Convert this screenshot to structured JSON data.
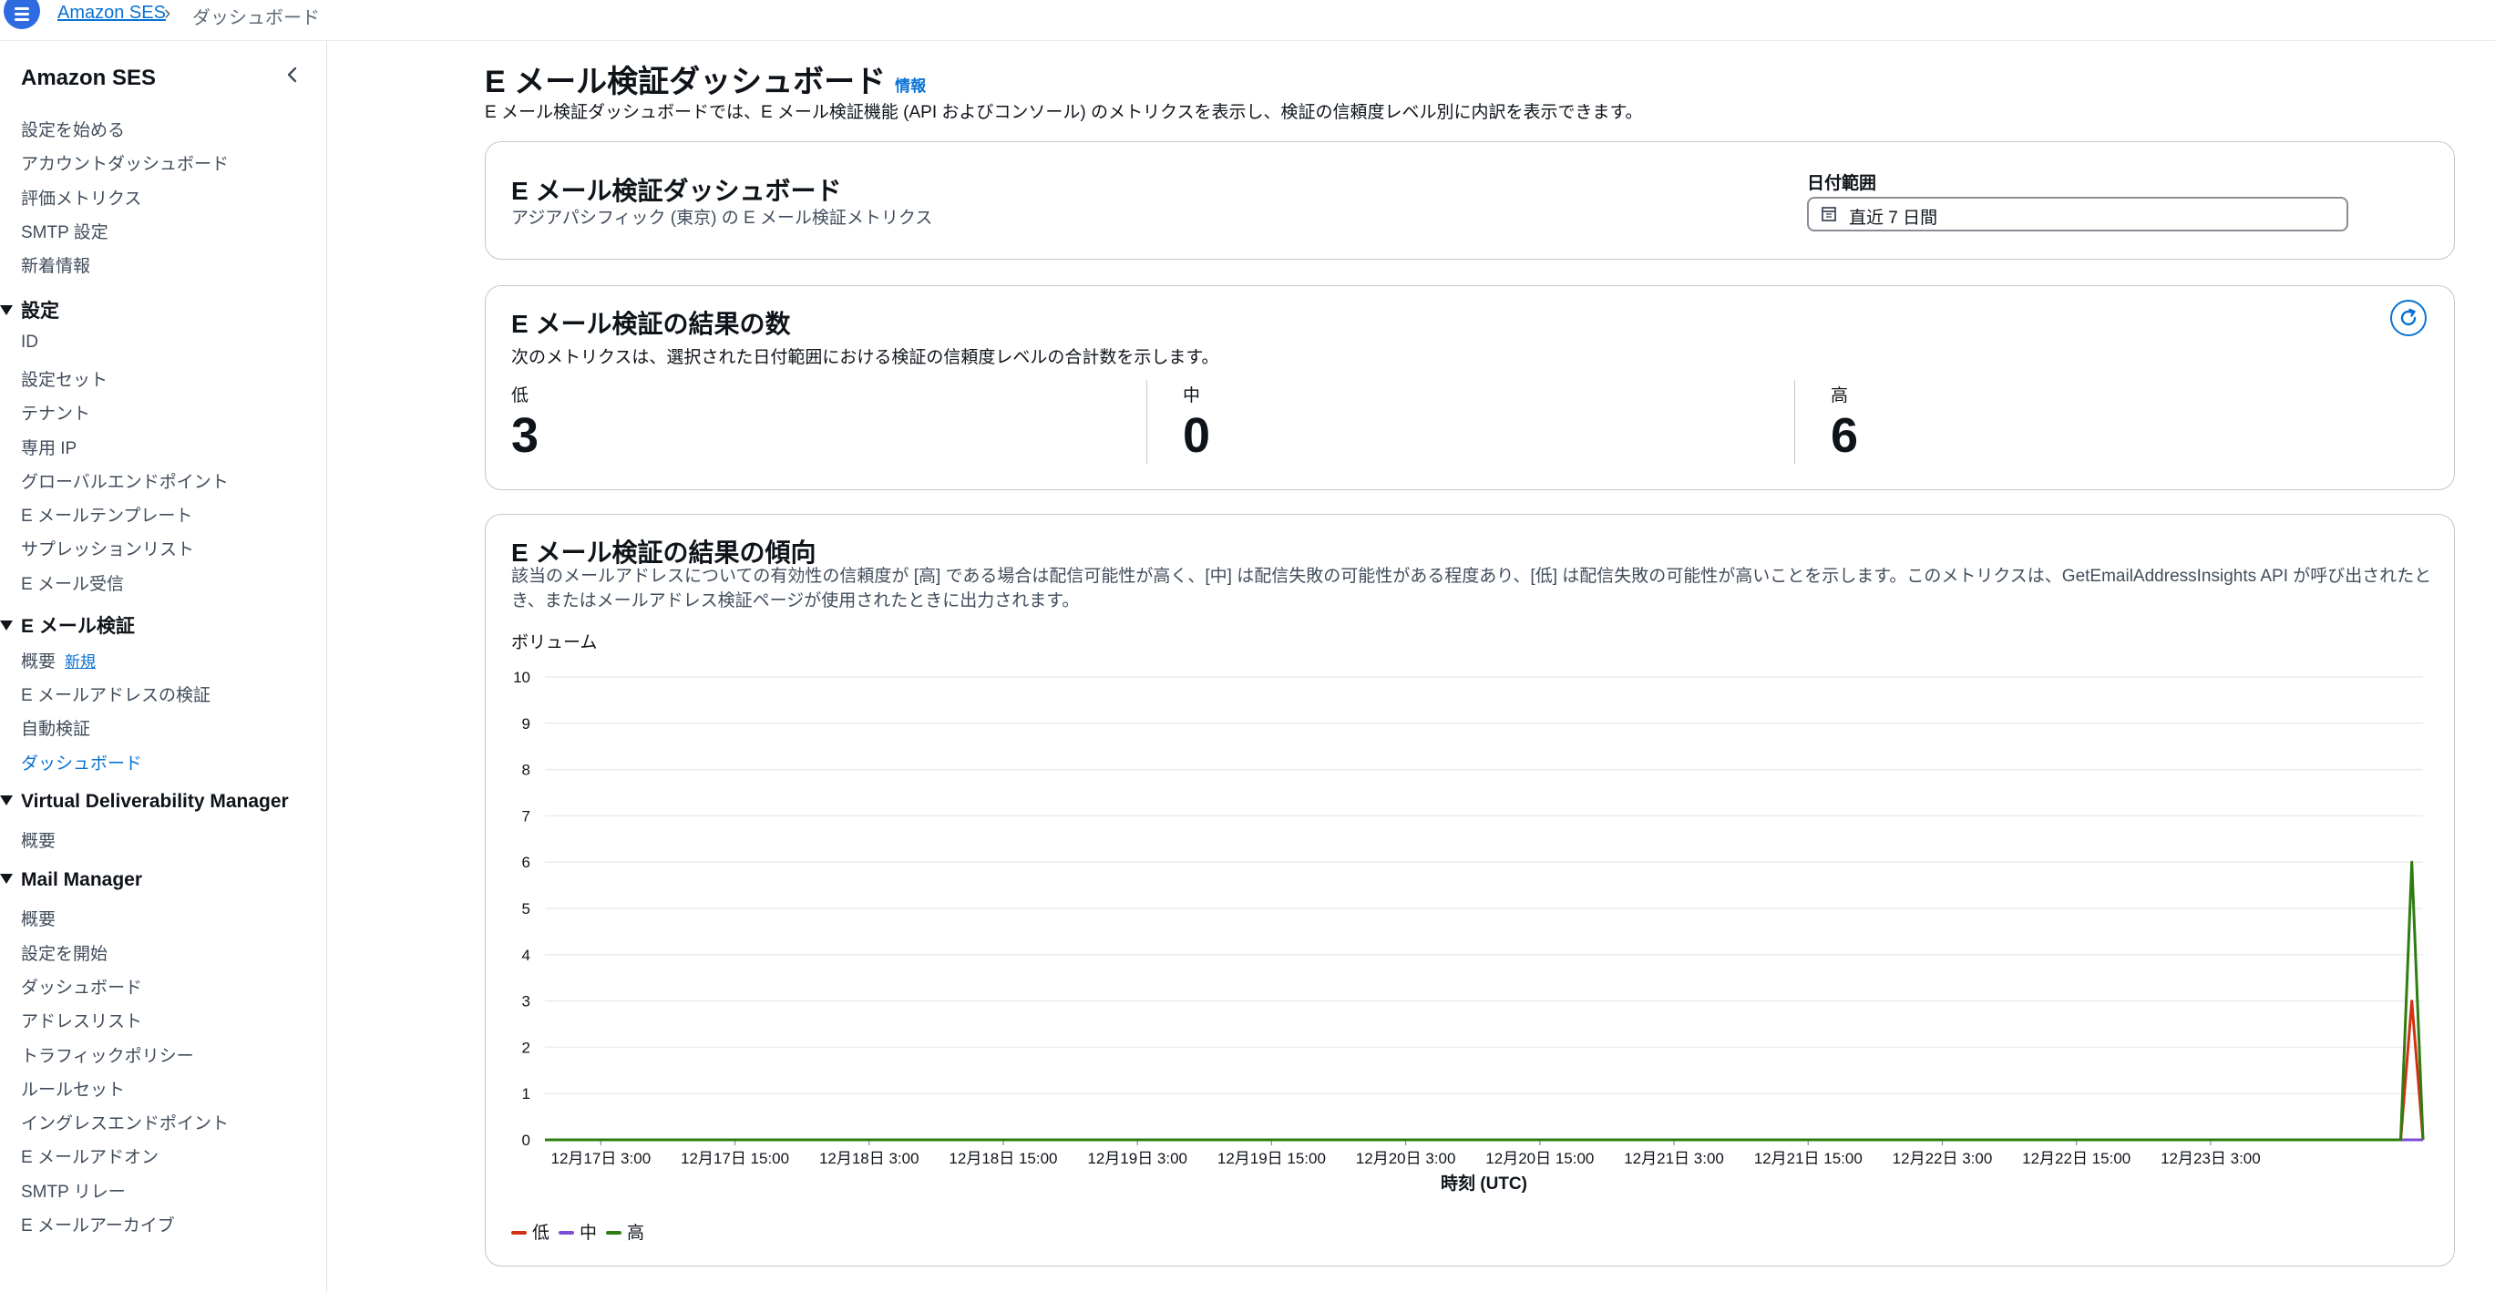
{
  "breadcrumb": {
    "root": "Amazon SES",
    "current": "ダッシュボード"
  },
  "sidebar": {
    "title": "Amazon SES",
    "top_items": [
      "設定を始める",
      "アカウントダッシュボード",
      "評価メトリクス",
      "SMTP 設定",
      "新着情報"
    ],
    "sections": [
      {
        "title": "設定",
        "items": [
          "ID",
          "設定セット",
          "テナント",
          "専用 IP",
          "グローバルエンドポイント",
          "E メールテンプレート",
          "サプレッションリスト",
          "E メール受信"
        ]
      },
      {
        "title": "E メール検証",
        "items": [
          "概要",
          "E メールアドレスの検証",
          "自動検証",
          "ダッシュボード"
        ],
        "new_badge": "新規",
        "active": "ダッシュボード"
      },
      {
        "title": "Virtual Deliverability Manager",
        "items": [
          "概要"
        ]
      },
      {
        "title": "Mail Manager",
        "items": [
          "概要",
          "設定を開始",
          "ダッシュボード",
          "アドレスリスト",
          "トラフィックポリシー",
          "ルールセット",
          "イングレスエンドポイント",
          "E メールアドオン",
          "SMTP リレー",
          "E メールアーカイブ"
        ]
      }
    ]
  },
  "page": {
    "title": "E メール検証ダッシュボード",
    "info_link": "情報",
    "description": "E メール検証ダッシュボードでは、E メール検証機能 (API およびコンソール) のメトリクスを表示し、検証の信頼度レベル別に内訳を表示できます。"
  },
  "summary_card": {
    "title": "E メール検証ダッシュボード",
    "subtitle": "アジアパシフィック (東京) の E メール検証メトリクス",
    "date_range_label": "日付範囲",
    "date_range_value": "直近 7 日間"
  },
  "results_card": {
    "title": "E メール検証の結果の数",
    "description": "次のメトリクスは、選択された日付範囲における検証の信頼度レベルの合計数を示します。",
    "metrics": [
      {
        "label": "低",
        "value": "3"
      },
      {
        "label": "中",
        "value": "0"
      },
      {
        "label": "高",
        "value": "6"
      }
    ]
  },
  "trend_card": {
    "title": "E メール検証の結果の傾向",
    "description": "該当のメールアドレスについての有効性の信頼度が [高] である場合は配信可能性が高く、[中] は配信失敗の可能性がある程度あり、[低] は配信失敗の可能性が高いことを示します。このメトリクスは、GetEmailAddressInsights API が呼び出されたとき、またはメールアドレス検証ページが使用されたときに出力されます。"
  },
  "chart_data": {
    "type": "line",
    "ylabel": "ボリューム",
    "xlabel": "時刻 (UTC)",
    "ylim": [
      0,
      10
    ],
    "yticks": [
      0,
      1,
      2,
      3,
      4,
      5,
      6,
      7,
      8,
      9,
      10
    ],
    "x_range": [
      "2025-12-16T22:00",
      "2025-12-23T22:00"
    ],
    "x_ticks": [
      "12月17日 3:00",
      "12月17日 15:00",
      "12月18日 3:00",
      "12月18日 15:00",
      "12月19日 3:00",
      "12月19日 15:00",
      "12月20日 3:00",
      "12月20日 15:00",
      "12月21日 3:00",
      "12月21日 15:00",
      "12月22日 3:00",
      "12月22日 15:00",
      "12月23日 3:00"
    ],
    "x_tick_times": [
      "2025-12-17T03:00",
      "2025-12-17T15:00",
      "2025-12-18T03:00",
      "2025-12-18T15:00",
      "2025-12-19T03:00",
      "2025-12-19T15:00",
      "2025-12-20T03:00",
      "2025-12-20T15:00",
      "2025-12-21T03:00",
      "2025-12-21T15:00",
      "2025-12-22T03:00",
      "2025-12-22T15:00",
      "2025-12-23T03:00"
    ],
    "grid": true,
    "legend": "bottom-left",
    "series": [
      {
        "name": "低",
        "color": "#d13212",
        "points": [
          [
            "2025-12-16T22:00",
            0
          ],
          [
            "2025-12-23T20:00",
            0
          ],
          [
            "2025-12-23T21:00",
            3
          ],
          [
            "2025-12-23T22:00",
            0
          ]
        ]
      },
      {
        "name": "中",
        "color": "#7d4dd6",
        "points": [
          [
            "2025-12-16T22:00",
            0
          ],
          [
            "2025-12-23T22:00",
            0
          ]
        ]
      },
      {
        "name": "高",
        "color": "#2e7d10",
        "points": [
          [
            "2025-12-16T22:00",
            0
          ],
          [
            "2025-12-23T20:00",
            0
          ],
          [
            "2025-12-23T21:00",
            6
          ],
          [
            "2025-12-23T22:00",
            0
          ]
        ]
      }
    ]
  }
}
